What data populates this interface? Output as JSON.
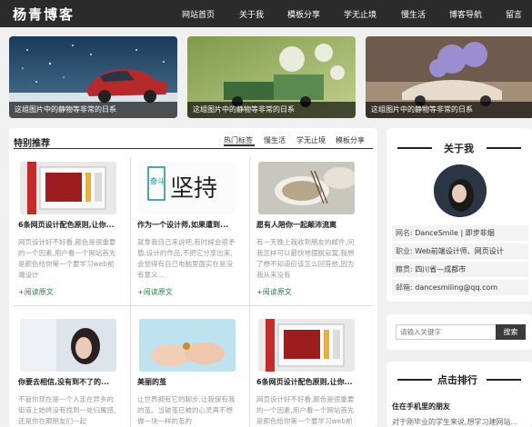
{
  "header": {
    "logo": "杨青博客",
    "nav": [
      "网站首页",
      "关于我",
      "模板分享",
      "学无止境",
      "慢生活",
      "博客导航",
      "留言"
    ]
  },
  "banners": [
    {
      "caption": "这组图片中的静物等非常的日系"
    },
    {
      "caption": "这组图片中的静物等非常的日系"
    },
    {
      "caption": "这组图片中的静物等非常的日系"
    }
  ],
  "featured": {
    "title": "特别推荐",
    "tabs": [
      "热门标签",
      "慢生活",
      "学无止境",
      "模板分享"
    ],
    "read_more": "+阅读原文",
    "cards": [
      {
        "title": "6条网页设计配色原则,让你...",
        "desc": "网页设计好不好看,颜色是很重要的一个因素,用户看一个网站首先是颜色给你第一个要学习web前端设计"
      },
      {
        "title": "作为一个设计师,如果遭到...",
        "desc": "就拿我自己来说吧,有时候会很矛盾,设计的作品,不把它分享出来,会觉得有自己电脑里面实在是没有意义..."
      },
      {
        "title": "愿有人陪你一起颠沛流离",
        "desc": "有一天晚上我收到朋友的邮件,问我怎样可以最快地摆脱寂寞,我想了想不知道应该怎么回答他,因为我从来没有"
      },
      {
        "title": "你要去相信,没有到不了的...",
        "desc": "不管你现在是一个人走在异乡的街道上始终没有找到一处归属感,还是你在跟朋友们一起"
      },
      {
        "title": "美丽的茧",
        "desc": "让世界拥有它的脚步,让我保有我的茧。当破茧已被的心灵再不想做一块一样的茧的"
      },
      {
        "title": "6条网页设计配色原则,让你...",
        "desc": "网页设计好不好看,颜色是很重要的一个因素,用户看一个网站首先是颜色给你第一个要学习web前端设计"
      }
    ],
    "card2_art": "坚持",
    "card2_small": "奋斗"
  },
  "about": {
    "title": "关于我",
    "rows": [
      {
        "label": "网名:",
        "value": "DanceSmile | 即步非烟"
      },
      {
        "label": "职业:",
        "value": "Web前端设计师、网页设计"
      },
      {
        "label": "籍贯:",
        "value": "四川省—成都市"
      },
      {
        "label": "邮箱:",
        "value": "dancesmiling@qq.com"
      }
    ]
  },
  "search": {
    "placeholder": "请输入关键字",
    "button": "搜索"
  },
  "rank": {
    "title": "点击排行",
    "items": [
      "住在手机里的朋友",
      "对于刚毕业的学生来说,想学习建网站..."
    ]
  },
  "colors": {
    "nav_bg": "#2b2b2b",
    "accent_green": "#2a7a48",
    "page_bg": "#f0f0f0"
  }
}
